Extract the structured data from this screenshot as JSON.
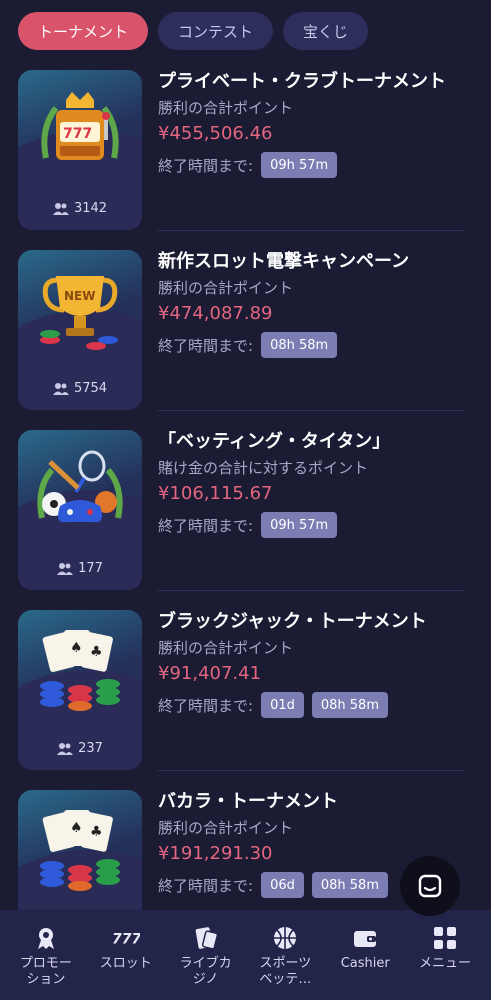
{
  "tabs": [
    {
      "label": "トーナメント",
      "active": true
    },
    {
      "label": "コンテスト",
      "active": false
    },
    {
      "label": "宝くじ",
      "active": false
    }
  ],
  "tournaments": [
    {
      "title": "プライベート・クラブトーナメント",
      "subtitle": "勝利の合計ポイント",
      "amount": "¥455,506.46",
      "timer_label": "終了時間まで:",
      "chips": [
        "09h 57m"
      ],
      "players": "3142",
      "icon": "slot-machine-icon"
    },
    {
      "title": "新作スロット電撃キャンペーン",
      "subtitle": "勝利の合計ポイント",
      "amount": "¥474,087.89",
      "timer_label": "終了時間まで:",
      "chips": [
        "08h 58m"
      ],
      "players": "5754",
      "icon": "trophy-icon"
    },
    {
      "title": "「ベッティング・タイタン」",
      "subtitle": "賭け金の合計に対するポイント",
      "amount": "¥106,115.67",
      "timer_label": "終了時間まで:",
      "chips": [
        "09h 57m"
      ],
      "players": "177",
      "icon": "sports-icon"
    },
    {
      "title": "ブラックジャック・トーナメント",
      "subtitle": "勝利の合計ポイント",
      "amount": "¥91,407.41",
      "timer_label": "終了時間まで:",
      "chips": [
        "01d",
        "08h 58m"
      ],
      "players": "237",
      "icon": "cards-chips-icon"
    },
    {
      "title": "バカラ・トーナメント",
      "subtitle": "勝利の合計ポイント",
      "amount": "¥191,291.30",
      "timer_label": "終了時間まで:",
      "chips": [
        "06d",
        "08h 58m"
      ],
      "players": "",
      "icon": "cards-chips-icon"
    }
  ],
  "bottom_nav": [
    {
      "label": "プロモー\nション",
      "icon": "medal-icon"
    },
    {
      "label": "スロット",
      "icon": "777-icon"
    },
    {
      "label": "ライブカ\nジノ",
      "icon": "live-casino-icon"
    },
    {
      "label": "スポーツ\nベッテ…",
      "icon": "basketball-icon"
    },
    {
      "label": "Cashier",
      "icon": "wallet-icon"
    },
    {
      "label": "メニュー",
      "icon": "grid-icon"
    }
  ],
  "colors": {
    "accent": "#d9546b",
    "amount": "#e3657f",
    "chip": "#7c7db3",
    "background": "#1b1c33"
  }
}
